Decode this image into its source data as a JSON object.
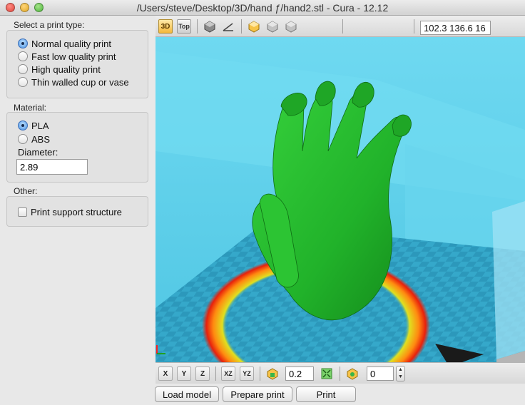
{
  "window": {
    "title": "/Users/steve/Desktop/3D/hand ƒ/hand2.stl - Cura - 12.12"
  },
  "print_type": {
    "label": "Select a print type:",
    "options": [
      {
        "label": "Normal quality print",
        "selected": true
      },
      {
        "label": "Fast low quality print",
        "selected": false
      },
      {
        "label": "High quality print",
        "selected": false
      },
      {
        "label": "Thin walled cup or vase",
        "selected": false
      }
    ]
  },
  "material": {
    "label": "Material:",
    "options": [
      {
        "label": "PLA",
        "selected": true
      },
      {
        "label": "ABS",
        "selected": false
      }
    ],
    "diameter_label": "Diameter:",
    "diameter_value": "2.89"
  },
  "other": {
    "label": "Other:",
    "support_label": "Print support structure",
    "support_checked": false
  },
  "view_toolbar": {
    "buttons": [
      {
        "name": "view-3d-icon",
        "text": "3D"
      },
      {
        "name": "view-top-icon",
        "text": "Top"
      },
      {
        "name": "view-normal-icon",
        "text": ""
      },
      {
        "name": "view-transparent-icon",
        "text": ""
      },
      {
        "name": "view-xray-icon",
        "text": ""
      },
      {
        "name": "view-overhang-icon",
        "text": ""
      },
      {
        "name": "view-layers-icon",
        "text": ""
      }
    ],
    "coordinates": "102.3 136.6 16"
  },
  "transform_toolbar": {
    "rotate_x": "X",
    "rotate_y": "Y",
    "rotate_z": "Z",
    "mirror_xz": "XZ",
    "mirror_yz": "YZ",
    "scale_value": "0.2",
    "rotate_value": "0"
  },
  "actions": {
    "load": "Load model",
    "prepare": "Prepare print",
    "print": "Print"
  },
  "colors": {
    "viewport_bg": "#5fd4ed",
    "bed": "#2e9fc0",
    "model": "#22b82a",
    "accent": "#4b93e2"
  }
}
